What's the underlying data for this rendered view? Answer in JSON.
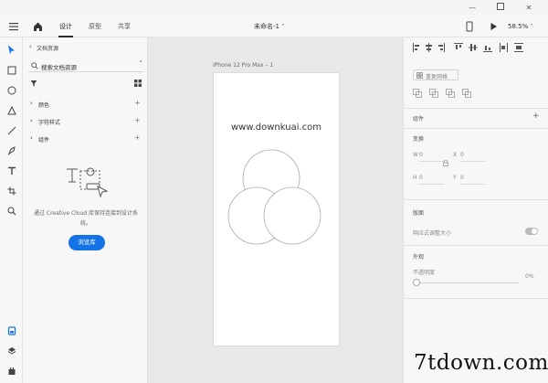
{
  "toolbar": {
    "tabs": [
      {
        "label": "设计",
        "active": true
      },
      {
        "label": "原型",
        "active": false
      },
      {
        "label": "共享",
        "active": false
      }
    ],
    "doc_title": "未命名-1",
    "zoom": "58.5%"
  },
  "left_panel": {
    "header": "文档资源",
    "search_placeholder": "搜索文档资源",
    "sections": [
      "颜色",
      "字符样式",
      "组件"
    ],
    "empty_message": "通过 Creative Cloud 库保持连接到设计系统。",
    "cc_button": "浏览库"
  },
  "canvas": {
    "artboard_label": "iPhone 12 Pro Max – 1",
    "artboard_text": "www.downkuai.com"
  },
  "right_panel": {
    "repeat_grid": "重复网格",
    "component_label": "组件",
    "transform_label": "变换",
    "w_label": "W",
    "w_value": "0",
    "x_label": "X",
    "x_value": "0",
    "h_label": "H",
    "h_value": "0",
    "y_label": "Y",
    "y_value": "0",
    "layout_label": "版面",
    "responsive_label": "响应式调整大小",
    "appearance_label": "外观",
    "opacity_label": "不透明度",
    "opacity_value": "0%"
  },
  "watermark": "7tdown.com"
}
